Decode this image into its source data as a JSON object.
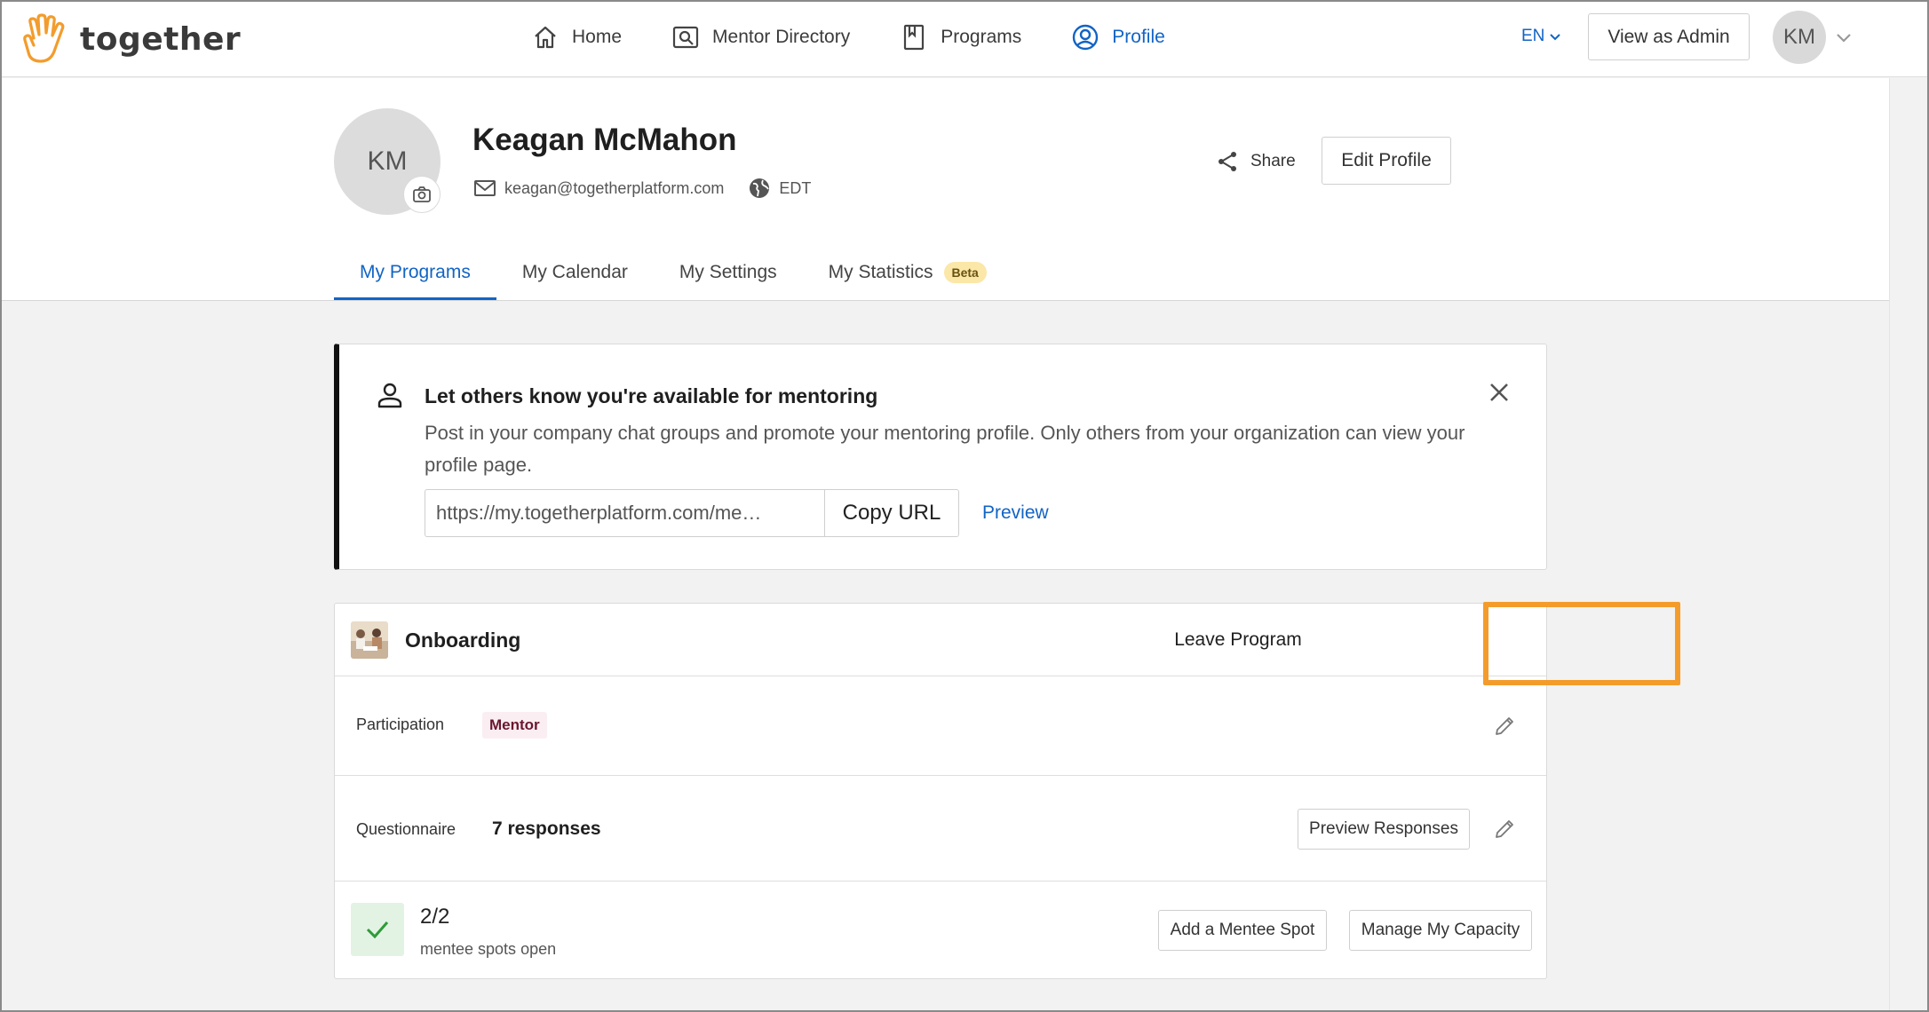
{
  "app": {
    "name": "together"
  },
  "nav": {
    "items": [
      {
        "label": "Home",
        "icon": "home-icon"
      },
      {
        "label": "Mentor Directory",
        "icon": "directory-icon"
      },
      {
        "label": "Programs",
        "icon": "bookmark-icon"
      },
      {
        "label": "Profile",
        "icon": "profile-icon",
        "active": true
      }
    ],
    "language": "EN",
    "admin_button": "View as Admin",
    "avatar_initials": "KM"
  },
  "profile": {
    "initials": "KM",
    "name": "Keagan McMahon",
    "email": "keagan@togetherplatform.com",
    "timezone": "EDT",
    "share_label": "Share",
    "edit_label": "Edit Profile"
  },
  "tabs": [
    {
      "label": "My Programs",
      "active": true
    },
    {
      "label": "My Calendar"
    },
    {
      "label": "My Settings"
    },
    {
      "label": "My Statistics",
      "badge": "Beta"
    }
  ],
  "availability": {
    "title": "Let others know you're available for mentoring",
    "body": "Post in your company chat groups and promote your mentoring profile. Only others from your organization can view your profile page.",
    "url_value": "https://my.togetherplatform.com/me…",
    "copy_label": "Copy URL",
    "preview_label": "Preview"
  },
  "program": {
    "title": "Onboarding",
    "leave_label": "Leave Program",
    "participation_label": "Participation",
    "participation_role": "Mentor",
    "questionnaire_label": "Questionnaire",
    "responses": "7 responses",
    "preview_responses_label": "Preview Responses",
    "spots": "2/2",
    "spots_label": "mentee spots open",
    "add_spot_label": "Add a Mentee Spot",
    "manage_capacity_label": "Manage My Capacity"
  },
  "colors": {
    "accent": "#1264c4",
    "highlight": "#f39c2c",
    "logo": "#f39c2c",
    "mentor_badge_bg": "#fbeef2",
    "beta_badge_bg": "#fbe7a8",
    "check_green": "#2e9b3a"
  }
}
